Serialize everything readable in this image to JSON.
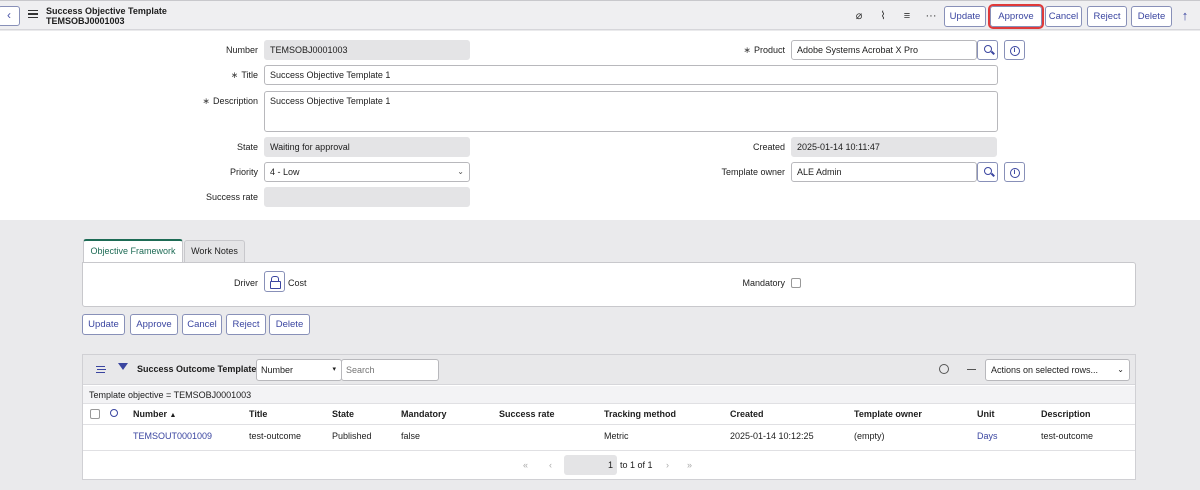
{
  "header": {
    "title": "Success Objective Template",
    "record_number": "TEMSOBJ0001003",
    "buttons": [
      "Update",
      "Approve",
      "Cancel",
      "Reject",
      "Delete"
    ],
    "icons": [
      "attachment-icon",
      "activity-icon",
      "settings-sliders-icon",
      "more-icon"
    ]
  },
  "form": {
    "number_label": "Number",
    "number_value": "TEMSOBJ0001003",
    "title_label": "Title",
    "title_value": "Success Objective Template 1",
    "description_label": "Description",
    "description_value": "Success Objective Template 1",
    "state_label": "State",
    "state_value": "Waiting for approval",
    "priority_label": "Priority",
    "priority_value": "4 - Low",
    "success_rate_label": "Success rate",
    "success_rate_value": "",
    "product_label": "Product",
    "product_value": "Adobe Systems Acrobat X Pro",
    "created_label": "Created",
    "created_value": "2025-01-14 10:11:47",
    "template_owner_label": "Template owner",
    "template_owner_value": "ALE Admin",
    "required_mark": "∗"
  },
  "tabs": [
    {
      "label": "Objective Framework",
      "active": true
    },
    {
      "label": "Work Notes",
      "active": false
    }
  ],
  "framework": {
    "driver_label": "Driver",
    "driver_value": "Cost",
    "mandatory_label": "Mandatory",
    "mandatory_checked": false
  },
  "actions": [
    "Update",
    "Approve",
    "Cancel",
    "Reject",
    "Delete"
  ],
  "related_list": {
    "title": "Success Outcome Templates",
    "search_field": "Number",
    "search_placeholder": "Search",
    "actions_select": "Actions on selected rows...",
    "filter": "Template objective = TEMSOBJ0001003",
    "columns": [
      "Number",
      "Title",
      "State",
      "Mandatory",
      "Success rate",
      "Tracking method",
      "Created",
      "Template owner",
      "Unit",
      "Description"
    ],
    "sort_indicator": "▲",
    "rows": [
      {
        "number": "TEMSOUT0001009",
        "title": "test-outcome",
        "state": "Published",
        "mandatory": "false",
        "success_rate": "",
        "tracking_method": "Metric",
        "created": "2025-01-14 10:12:25",
        "template_owner": "(empty)",
        "unit": "Days",
        "description": "test-outcome"
      }
    ],
    "pager": {
      "current": "1",
      "text": "to 1 of 1"
    }
  },
  "colors": {
    "accent": "#3a45a0",
    "active_tab": "#1d6b55",
    "highlight": "#e03a3a"
  }
}
